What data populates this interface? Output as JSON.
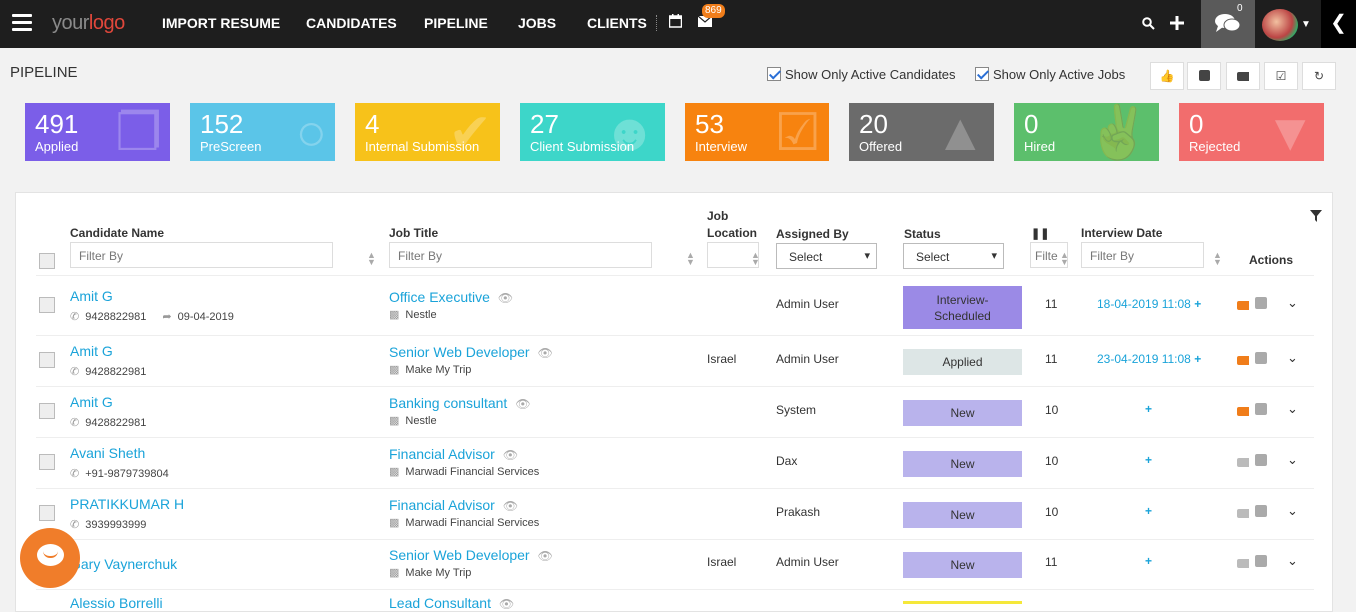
{
  "nav": {
    "logo_a": "your",
    "logo_b": "logo",
    "items": [
      "IMPORT RESUME",
      "CANDIDATES",
      "PIPELINE",
      "JOBS",
      "CLIENTS"
    ],
    "mail_badge": "869",
    "chat_badge": "0",
    "icons": [
      "menu-icon",
      "calendar-icon",
      "mail-icon",
      "search-icon",
      "plus-icon",
      "chat-icon",
      "avatar",
      "chevron-down-icon",
      "chevron-left-icon"
    ]
  },
  "page": {
    "title": "PIPELINE",
    "show_active_candidates": "Show Only Active Candidates",
    "show_active_jobs": "Show Only Active Jobs",
    "toolbar_icons": [
      "thumbs-up-icon",
      "phone-icon",
      "tags-icon",
      "check-square-icon",
      "refresh-icon"
    ]
  },
  "cards": [
    {
      "count": "491",
      "label": "Applied",
      "color": "#7b5ee8"
    },
    {
      "count": "152",
      "label": "PreScreen",
      "color": "#5bc5e8"
    },
    {
      "count": "4",
      "label": "Internal Submission",
      "color": "#f7c21a"
    },
    {
      "count": "27",
      "label": "Client Submission",
      "color": "#3dd6c9"
    },
    {
      "count": "53",
      "label": "Interview",
      "color": "#f7830f"
    },
    {
      "count": "20",
      "label": "Offered",
      "color": "#6b6b6b"
    },
    {
      "count": "0",
      "label": "Hired",
      "color": "#5cbf6c"
    },
    {
      "count": "0",
      "label": "Rejected",
      "color": "#f26d6d"
    }
  ],
  "table": {
    "headers": {
      "candidate": "Candidate Name",
      "job_title": "Job Title",
      "job_location_1": "Job",
      "job_location_2": "Location",
      "assigned_by": "Assigned By",
      "status": "Status",
      "interview_date": "Interview Date",
      "actions": "Actions"
    },
    "filters": {
      "candidate": "Filter By",
      "job_title": "Filter By",
      "count": "Filte",
      "interview_date": "Filter By",
      "assigned_by": "Select",
      "status": "Select"
    },
    "rows": [
      {
        "name": "Amit G",
        "phone": "9428822981",
        "date": "09-04-2019",
        "job": "Office Executive",
        "company": "Nestle",
        "location": "",
        "assigned": "Admin User",
        "status": "Interview-Scheduled",
        "status_color": "#9b8ae6",
        "count": "11",
        "interview": "18-04-2019 11:08"
      },
      {
        "name": "Amit G",
        "phone": "9428822981",
        "date": "",
        "job": "Senior Web Developer",
        "company": "Make My Trip",
        "location": "Israel",
        "assigned": "Admin User",
        "status": "Applied",
        "status_color": "#dde6e6",
        "count": "11",
        "interview": "23-04-2019 11:08"
      },
      {
        "name": "Amit G",
        "phone": "9428822981",
        "date": "",
        "job": "Banking consultant",
        "company": "Nestle",
        "location": "",
        "assigned": "System",
        "status": "New",
        "status_color": "#b9b3ec",
        "count": "10",
        "interview": ""
      },
      {
        "name": "Avani Sheth",
        "phone": "+91-9879739804",
        "date": "",
        "job": "Financial Advisor",
        "company": "Marwadi Financial Services",
        "location": "",
        "assigned": "Dax",
        "status": "New",
        "status_color": "#b9b3ec",
        "count": "10",
        "interview": ""
      },
      {
        "name": "PRATIKKUMAR H",
        "phone": "3939993999",
        "date": "",
        "job": "Financial Advisor",
        "company": "Marwadi Financial Services",
        "location": "",
        "assigned": "Prakash",
        "status": "New",
        "status_color": "#b9b3ec",
        "count": "10",
        "interview": ""
      },
      {
        "name": "Gary Vaynerchuk",
        "phone": "",
        "date": "",
        "job": "Senior Web Developer",
        "company": "Make My Trip",
        "location": "Israel",
        "assigned": "Admin User",
        "status": "New",
        "status_color": "#b9b3ec",
        "count": "11",
        "interview": ""
      },
      {
        "name": "Alessio Borrelli",
        "phone": "",
        "date": "",
        "job": "Lead Consultant",
        "company": "",
        "location": "",
        "assigned": "",
        "status": "",
        "status_color": "#f5e83a",
        "count": "",
        "interview": ""
      }
    ]
  }
}
